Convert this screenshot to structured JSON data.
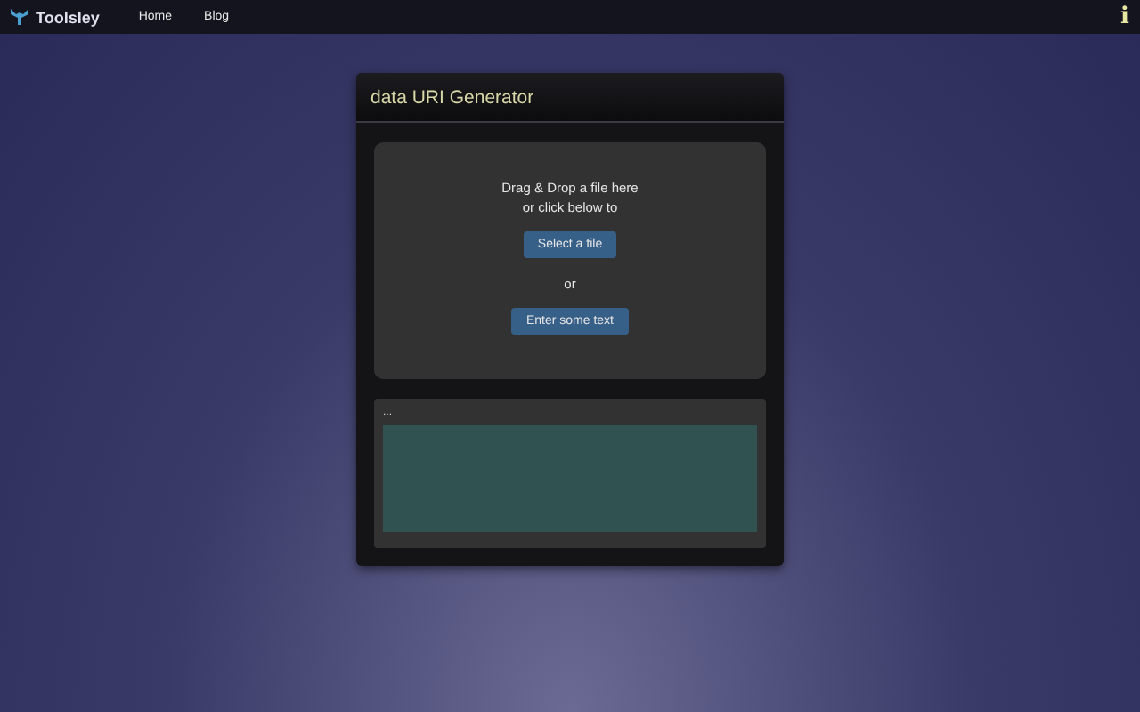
{
  "navbar": {
    "brand": "Toolsley",
    "links": [
      {
        "label": "Home"
      },
      {
        "label": "Blog"
      }
    ],
    "info": "i"
  },
  "card": {
    "title": "data URI Generator",
    "dropzone": {
      "text": "Drag & Drop a file here\nor click below to",
      "select_button": "Select a file",
      "separator": "or",
      "text_button": "Enter some text"
    },
    "output": {
      "label": "..."
    }
  }
}
